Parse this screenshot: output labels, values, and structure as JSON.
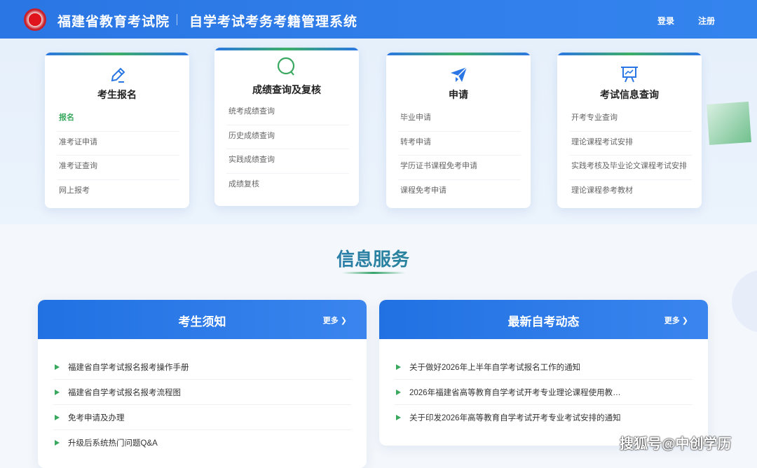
{
  "header": {
    "org": "福建省教育考试院",
    "system": "自学考试考务考籍管理系统",
    "login": "登录",
    "register": "注册"
  },
  "cards": [
    {
      "title": "考生报名",
      "icon": "pencil-icon",
      "items": [
        "报名",
        "准考证申请",
        "准考证查询",
        "网上报考"
      ],
      "active": 0
    },
    {
      "title": "成绩查询及复核",
      "icon": "search-icon",
      "items": [
        "统考成绩查询",
        "历史成绩查询",
        "实践成绩查询",
        "成绩复核"
      ]
    },
    {
      "title": "申请",
      "icon": "paper-plane-icon",
      "items": [
        "毕业申请",
        "转考申请",
        "学历证书课程免考申请",
        "课程免考申请"
      ]
    },
    {
      "title": "考试信息查询",
      "icon": "presentation-chart-icon",
      "items": [
        "开考专业查询",
        "理论课程考试安排",
        "实践考核及毕业论文课程考试安排",
        "理论课程参考教材"
      ]
    }
  ],
  "section": {
    "title": "信息服务"
  },
  "panels": [
    {
      "title": "考生须知",
      "more": "更多",
      "items": [
        "福建省自学考试报名报考操作手册",
        "福建省自学考试报名报考流程图",
        "免考申请及办理",
        "升级后系统热门问题Q&A"
      ]
    },
    {
      "title": "最新自考动态",
      "more": "更多",
      "items": [
        "关于做好2026年上半年自学考试报名工作的通知",
        "2026年福建省高等教育自学考试开考专业理论课程使用教…",
        "关于印发2026年高等教育自学考试开考专业考试安排的通知"
      ]
    }
  ],
  "watermark": "搜狐号@中创学历",
  "colors": {
    "primary": "#2a76e4",
    "accent_green": "#3aa95f"
  }
}
